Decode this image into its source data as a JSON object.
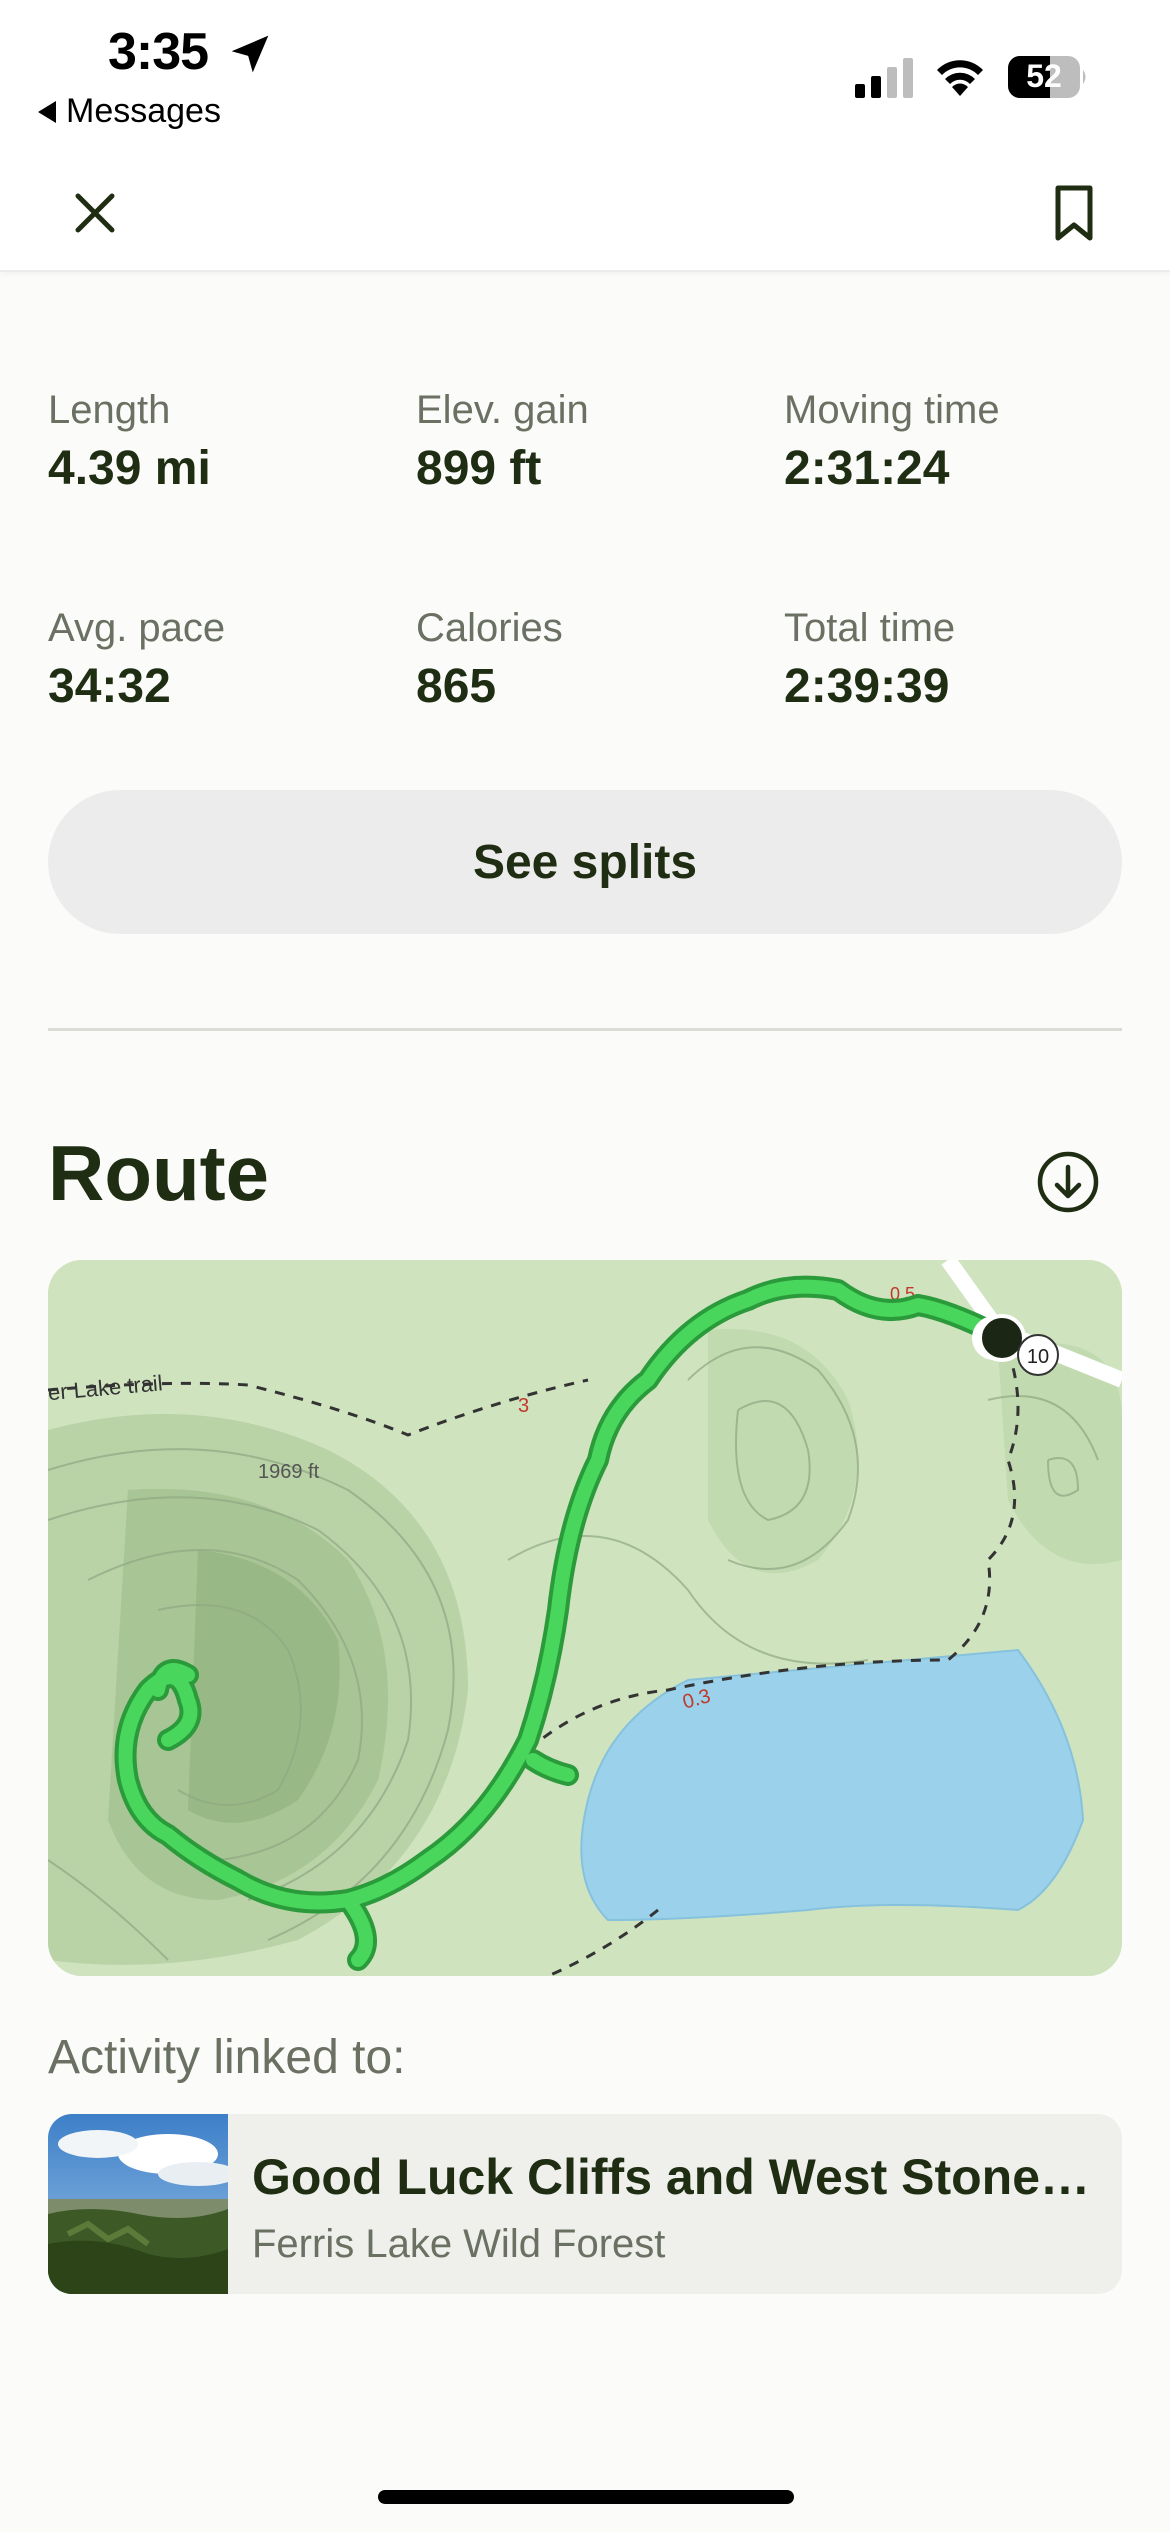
{
  "status_bar": {
    "time": "3:35",
    "back_label": "Messages",
    "battery": "52"
  },
  "nav": {
    "close_icon": "close-icon",
    "bookmark_icon": "bookmark-icon"
  },
  "stats": [
    {
      "label": "Length",
      "value": "4.39 mi"
    },
    {
      "label": "Elev. gain",
      "value": "899 ft"
    },
    {
      "label": "Moving time",
      "value": "2:31:24"
    },
    {
      "label": "Avg. pace",
      "value": "34:32"
    },
    {
      "label": "Calories",
      "value": "865"
    },
    {
      "label": "Total time",
      "value": "2:39:39"
    }
  ],
  "splits_button": "See splits",
  "route": {
    "title": "Route",
    "map": {
      "trail_label": "er Lake trail",
      "elevation_label": "1969 ft",
      "marker_3": "3",
      "marker_03": "0.3",
      "marker_05": "0.5",
      "road_number": "10"
    }
  },
  "linked": {
    "label": "Activity linked to:",
    "title": "Good Luck Cliffs and West Stoner L...",
    "subtitle": "Ferris Lake Wild Forest"
  },
  "colors": {
    "accent_dark": "#1f2d12",
    "route_green": "#3fcf55",
    "lake_blue": "#9bd1ea",
    "map_green": "#cfe3bf"
  }
}
